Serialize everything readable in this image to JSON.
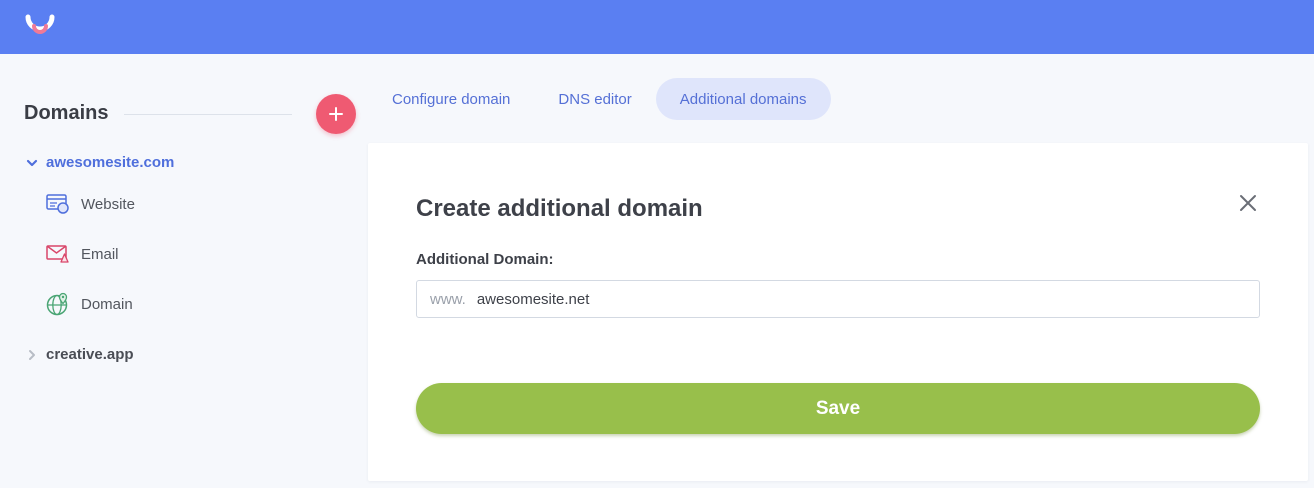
{
  "header": {
    "logo_icon": "smile-logo-icon",
    "background": "#5a7ff2"
  },
  "sidebar": {
    "title": "Domains",
    "add_icon": "plus-icon",
    "domains": [
      {
        "name": "awesomesite.com",
        "expanded": true,
        "items": [
          {
            "label": "Website",
            "icon": "browser-icon"
          },
          {
            "label": "Email",
            "icon": "envelope-icon"
          },
          {
            "label": "Domain",
            "icon": "globe-icon"
          }
        ]
      },
      {
        "name": "creative.app",
        "expanded": false
      }
    ]
  },
  "tabs": [
    {
      "label": "Configure domain",
      "active": false
    },
    {
      "label": "DNS editor",
      "active": false
    },
    {
      "label": "Additional domains",
      "active": true
    }
  ],
  "form": {
    "title": "Create additional domain",
    "field_label": "Additional Domain:",
    "prefix": "www.",
    "value": "awesomesite.net",
    "save_label": "Save",
    "close_icon": "close-icon"
  },
  "colors": {
    "accent": "#5a7ff2",
    "add_button": "#ef5a72",
    "save_button": "#98bf4b",
    "active_tab_bg": "#dfe5fb"
  }
}
